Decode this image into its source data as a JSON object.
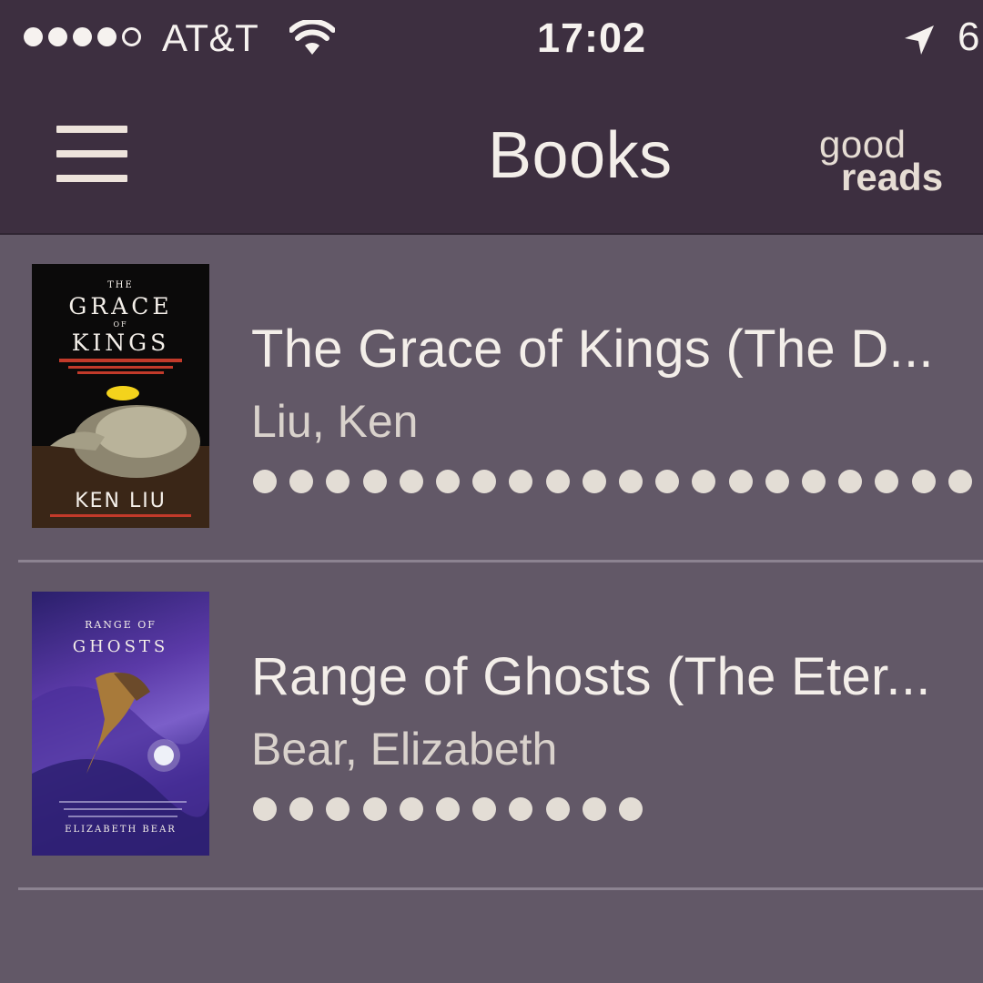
{
  "status_bar": {
    "signal_filled": 4,
    "signal_total": 5,
    "carrier": "AT&T",
    "time": "17:02",
    "battery_partial": "6"
  },
  "nav": {
    "title": "Books",
    "brand_top": "good",
    "brand_bottom": "reads"
  },
  "books": [
    {
      "title": "The Grace of Kings (The D...",
      "author": "Liu, Ken",
      "cover": {
        "line1": "THE",
        "line2": "GRACE",
        "line3": "OF",
        "line4": "KINGS",
        "author_line": "KEN LIU"
      },
      "progress_dots": 20
    },
    {
      "title": "Range of Ghosts (The Eter...",
      "author": "Bear, Elizabeth",
      "cover": {
        "line1": "RANGE OF",
        "line2": "GHOSTS",
        "author_line": "ELIZABETH BEAR"
      },
      "progress_dots": 11
    }
  ],
  "colors": {
    "status_bar_bg": "#3d2f40",
    "list_bg": "#625867",
    "divider": "#8c8391",
    "text_primary": "#f3eee9",
    "dot": "#e3ddd5"
  }
}
